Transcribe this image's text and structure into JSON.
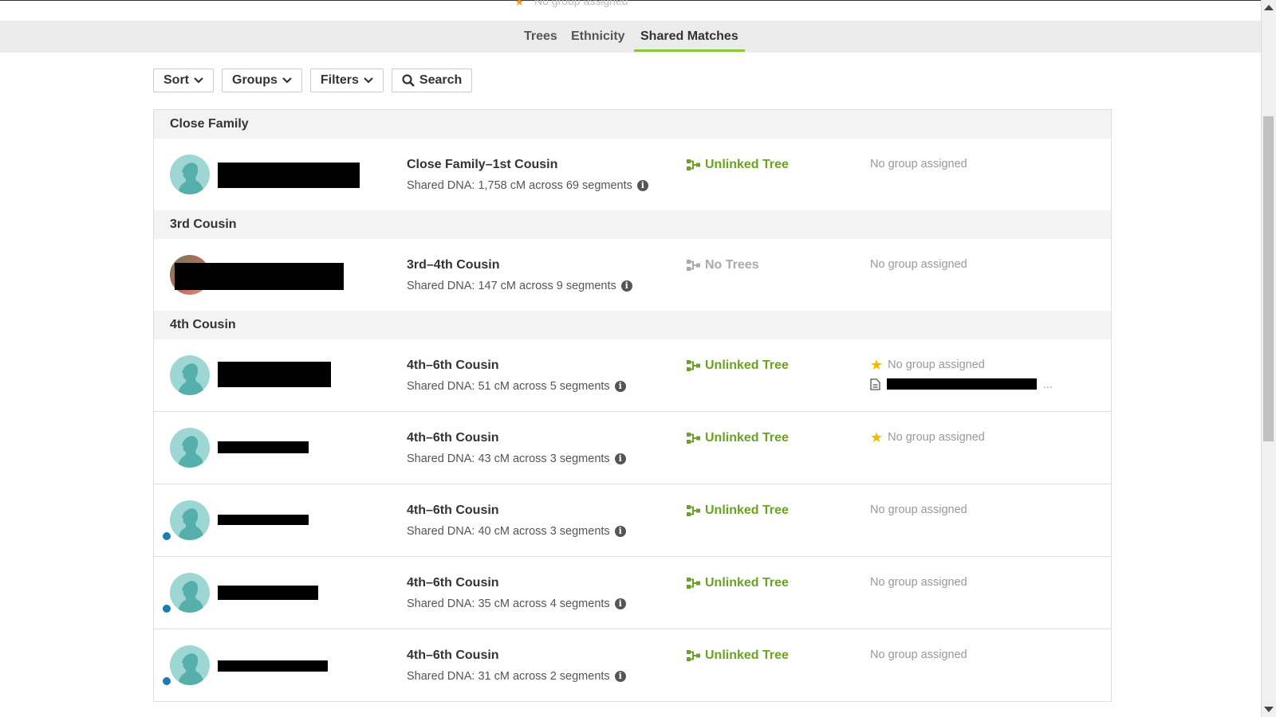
{
  "top_strip": {
    "peek_text": "No group assigned"
  },
  "tabs": [
    {
      "label": "Trees"
    },
    {
      "label": "Ethnicity"
    },
    {
      "label": "Shared Matches",
      "active": true
    }
  ],
  "toolbar": {
    "sort": "Sort",
    "groups": "Groups",
    "filters": "Filters",
    "search": "Search"
  },
  "sections": [
    {
      "title": "Close Family"
    },
    {
      "title": "3rd Cousin"
    },
    {
      "title": "4th Cousin"
    }
  ],
  "matches": [
    {
      "relationship": "Close Family–1st Cousin",
      "shared_dna": "Shared DNA: 1,758 cM across 69 segments",
      "tree": "Unlinked Tree",
      "group": "No group assigned",
      "starred": false
    },
    {
      "relationship": "3rd–4th Cousin",
      "shared_dna": "Shared DNA: 147 cM across 9 segments",
      "tree": "No Trees",
      "group": "No group assigned",
      "starred": false
    },
    {
      "relationship": "4th–6th Cousin",
      "shared_dna": "Shared DNA: 51 cM across 5 segments",
      "tree": "Unlinked Tree",
      "group": "No group assigned",
      "starred": true,
      "note_ellipsis": "..."
    },
    {
      "relationship": "4th–6th Cousin",
      "shared_dna": "Shared DNA: 43 cM across 3 segments",
      "tree": "Unlinked Tree",
      "group": "No group assigned",
      "starred": true
    },
    {
      "relationship": "4th–6th Cousin",
      "shared_dna": "Shared DNA: 40 cM across 3 segments",
      "tree": "Unlinked Tree",
      "group": "No group assigned",
      "starred": false
    },
    {
      "relationship": "4th–6th Cousin",
      "shared_dna": "Shared DNA: 35 cM across 4 segments",
      "tree": "Unlinked Tree",
      "group": "No group assigned",
      "starred": false
    },
    {
      "relationship": "4th–6th Cousin",
      "shared_dna": "Shared DNA: 31 cM across 2 segments",
      "tree": "Unlinked Tree",
      "group": "No group assigned",
      "starred": false
    }
  ],
  "colors": {
    "accent_green": "#6aa224",
    "tab_underline": "#8cc63f",
    "star": "#f5b800",
    "new_dot": "#1a7db0"
  }
}
